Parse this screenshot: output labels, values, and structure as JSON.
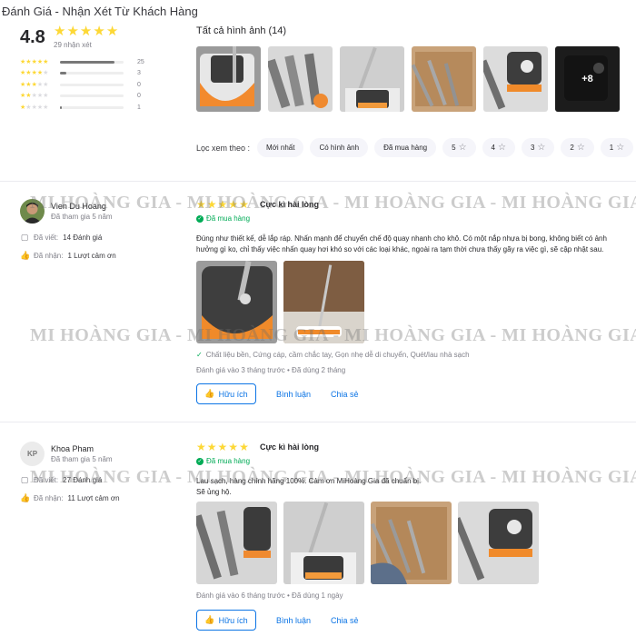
{
  "header": {
    "title": "Đánh Giá - Nhận Xét Từ Khách Hàng"
  },
  "summary": {
    "average": "4.8",
    "stars": 5,
    "review_count": "29 nhận xét",
    "distribution": [
      {
        "stars": 5,
        "count": "25",
        "fraction": 0.86
      },
      {
        "stars": 4,
        "count": "3",
        "fraction": 0.1
      },
      {
        "stars": 3,
        "count": "0",
        "fraction": 0
      },
      {
        "stars": 2,
        "count": "0",
        "fraction": 0
      },
      {
        "stars": 1,
        "count": "1",
        "fraction": 0.03
      }
    ]
  },
  "gallery": {
    "title": "Tất cả hình ảnh (14)",
    "more_label": "+8"
  },
  "filters": {
    "label": "Lọc xem theo :",
    "chips": [
      "Mới nhất",
      "Có hình ảnh",
      "Đã mua hàng",
      "5",
      "4",
      "3",
      "2",
      "1"
    ]
  },
  "watermark": "MI HOÀNG GIA - MI HOÀNG GIA - MI HOÀNG GIA - MI HOÀNG GIA",
  "reviews": [
    {
      "user": {
        "name": "Vien Du Hoang",
        "joined": "Đã tham gia 5 năm",
        "written_label": "Đã viết:",
        "written_value": "14 Đánh giá",
        "received_label": "Đã nhận:",
        "received_value": "1 Lượt cảm ơn"
      },
      "rating": 5,
      "title": "Cực kì hài lòng",
      "bought": "Đã mua hàng",
      "content": "Đúng như thiết kế, dễ lắp ráp. Nhấn mạnh để chuyển chế độ quay nhanh cho khô. Có một nắp nhựa bị bong, không biết có ảnh hưởng gì ko, chỉ thấy việc nhấn quay hơi khó so với các loại khác, ngoài ra tạm thời chưa thấy gãy ra việc gì, sẽ cập nhật sau.",
      "tags": "Chất liệu bền, Cứng cáp, cầm chắc tay, Gọn nhẹ dễ di chuyển, Quét/lau nhà sạch",
      "meta_posted": "Đánh giá vào 3 tháng trước",
      "meta_used": "Đã dùng 2 tháng",
      "helpful": "Hữu ích",
      "comment": "Bình luận",
      "share": "Chia sẻ"
    },
    {
      "user": {
        "name": "Khoa Pham",
        "initials": "KP",
        "joined": "Đã tham gia 5 năm",
        "written_label": "Đã viết:",
        "written_value": "27 Đánh giá",
        "received_label": "Đã nhận:",
        "received_value": "11 Lượt cảm ơn"
      },
      "rating": 5,
      "title": "Cực kì hài lòng",
      "bought": "Đã mua hàng",
      "content": "Lau sạch, hàng chính hãng 100%. Cảm ơn MiHoàng Gia đã chuẩn bị.",
      "content2": "Sẽ ủng hộ.",
      "meta_posted": "Đánh giá vào 6 tháng trước",
      "meta_used": "Đã dùng 1 ngày",
      "helpful": "Hữu ích",
      "comment": "Bình luận",
      "share": "Chia sẻ"
    }
  ]
}
